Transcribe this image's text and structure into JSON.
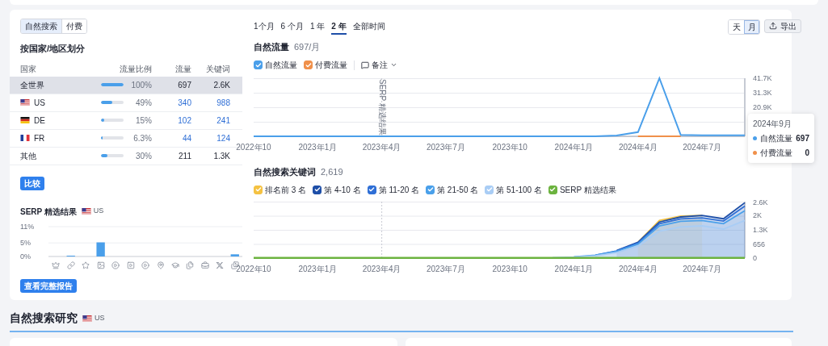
{
  "left": {
    "search_type_tabs": [
      {
        "label": "自然搜索",
        "selected": true
      },
      {
        "label": "付费",
        "selected": false
      }
    ],
    "country_title": "按国家/地区划分",
    "columns": [
      "国家",
      "流量比例",
      "流量",
      "关键词"
    ],
    "rows": [
      {
        "name": "全世界",
        "level": 1,
        "share": "100%",
        "traffic": "697",
        "keywords": "2.6K",
        "link": false,
        "selected": true
      },
      {
        "name": "US",
        "kind": "us",
        "level": 0.49,
        "share": "49%",
        "traffic": "340",
        "keywords": "988",
        "link": true,
        "selected": false
      },
      {
        "name": "DE",
        "kind": "de",
        "level": 0.15,
        "share": "15%",
        "traffic": "102",
        "keywords": "241",
        "link": true,
        "selected": false
      },
      {
        "name": "FR",
        "kind": "fr",
        "level": 0.063,
        "share": "6.3%",
        "traffic": "44",
        "keywords": "124",
        "link": true,
        "selected": false
      },
      {
        "name": "其他",
        "level": 0.3,
        "share": "30%",
        "traffic": "211",
        "keywords": "1.3K",
        "link": false,
        "selected": false
      }
    ],
    "compare_button": "比较",
    "serp": {
      "title": "SERP 精选结果",
      "country": {
        "code": "US",
        "kind": "us"
      },
      "chart_data": {
        "type": "bar",
        "values": [
          0,
          0.3,
          0,
          5.2,
          0,
          0,
          0,
          0,
          0,
          0,
          0,
          0,
          0.8
        ],
        "ylim": [
          0,
          11
        ],
        "yticks": [
          {
            "value": 0,
            "label": "0%"
          },
          {
            "value": 5,
            "label": "5%"
          },
          {
            "value": 11,
            "label": "11%"
          }
        ]
      }
    },
    "report_button": "查看完整报告"
  },
  "right": {
    "periods": [
      {
        "label": "1个月",
        "selected": false
      },
      {
        "label": "6 个月",
        "selected": false
      },
      {
        "label": "1 年",
        "selected": false
      },
      {
        "label": "2 年",
        "selected": true
      },
      {
        "label": "全部时间",
        "selected": false
      }
    ],
    "granularity": [
      {
        "label": "天",
        "selected": false
      },
      {
        "label": "月",
        "selected": true
      }
    ],
    "export_button": "导出",
    "traffic": {
      "title": "自然流量",
      "value": "697/月",
      "legend": [
        {
          "checked": true
        },
        {
          "checked": true
        }
      ],
      "notes_button": "备注",
      "chart_data": {
        "type": "line",
        "categories": [
          "2022年10",
          null,
          null,
          "2023年1月",
          null,
          null,
          "2023年4月",
          null,
          null,
          "2023年7月",
          null,
          null,
          "2023年10",
          null,
          null,
          "2024年1月",
          null,
          null,
          "2024年4月",
          null,
          null,
          "2024年7月",
          null,
          null
        ],
        "ylim": [
          0,
          41700
        ],
        "grid": true,
        "yticks": [
          {
            "value": 20900,
            "label": "20.9K"
          },
          {
            "value": 31300,
            "label": "31.3K"
          },
          {
            "value": 41700,
            "label": "41.7K"
          }
        ],
        "series": [
          {
            "name": "自然流量",
            "color": "#4a9fea",
            "values": [
              0,
              0,
              0,
              0,
              0,
              0,
              0,
              0,
              0,
              0,
              0,
              0,
              0,
              0,
              0,
              0,
              0,
              500,
              3000,
              41700,
              1000,
              700,
              700,
              700
            ]
          },
          {
            "name": "付费流量",
            "color": "#f0904a",
            "values": [
              null,
              null,
              null,
              null,
              null,
              null,
              null,
              null,
              null,
              null,
              null,
              null,
              null,
              null,
              null,
              null,
              null,
              null,
              0,
              0,
              0,
              null,
              null,
              null
            ]
          }
        ],
        "annotations": [
          {
            "x": "2023年4月",
            "text": "SERP 精选结果"
          }
        ]
      },
      "tooltip": {
        "title": "2024年9月",
        "rows": [
          {
            "label": "自然流量",
            "value": "697",
            "color": "#4a9fea"
          },
          {
            "label": "付费流量",
            "value": "0",
            "color": "#f0904a"
          }
        ]
      }
    },
    "keywords": {
      "title": "自然搜索关键词",
      "value": "2,619",
      "legend": [
        {
          "checked": true
        },
        {
          "checked": true
        },
        {
          "checked": true
        },
        {
          "checked": true
        },
        {
          "checked": true
        },
        {
          "checked": true
        }
      ],
      "chart_data": {
        "type": "area",
        "categories": [
          "2022年10",
          null,
          null,
          "2023年1月",
          null,
          null,
          "2023年4月",
          null,
          null,
          "2023年7月",
          null,
          null,
          "2023年10",
          null,
          null,
          "2024年1月",
          null,
          null,
          "2024年4月",
          null,
          null,
          "2024年7月",
          null,
          null
        ],
        "ylim": [
          0,
          2624
        ],
        "yticks": [
          {
            "value": 0,
            "label": "0"
          },
          {
            "value": 656,
            "label": "656"
          },
          {
            "value": 1300,
            "label": "1.3K"
          },
          {
            "value": 2000,
            "label": "2K"
          },
          {
            "value": 2600,
            "label": "2.6K"
          }
        ],
        "grid": true,
        "series": [
          {
            "name": "排名前 3 名",
            "color": "#f5c242",
            "values": [
              null,
              null,
              null,
              null,
              null,
              null,
              null,
              null,
              null,
              null,
              null,
              null,
              null,
              null,
              null,
              null,
              null,
              null,
              740,
              1750,
              1950,
              1980,
              null,
              null
            ]
          },
          {
            "name": "第 4-10 名",
            "color": "#1e4fa8",
            "values": [
              null,
              null,
              null,
              null,
              null,
              null,
              null,
              null,
              null,
              null,
              null,
              null,
              null,
              null,
              null,
              null,
              null,
              350,
              740,
              1680,
              1910,
              1980,
              1830,
              2570
            ]
          },
          {
            "name": "第 11-20 名",
            "color": "#2f6fd6",
            "values": [
              null,
              null,
              null,
              null,
              null,
              null,
              null,
              null,
              null,
              null,
              null,
              null,
              null,
              null,
              null,
              null,
              140,
              330,
              700,
              1600,
              1820,
              1870,
              1720,
              2420
            ]
          },
          {
            "name": "第 21-50 名",
            "color": "#4aa0ea",
            "values": [
              null,
              null,
              null,
              null,
              null,
              null,
              null,
              null,
              null,
              null,
              null,
              null,
              null,
              null,
              null,
              60,
              130,
              310,
              650,
              1500,
              1710,
              1750,
              1600,
              2200
            ]
          },
          {
            "name": "第 51-100 名",
            "color": "#a9cdf5",
            "values": [
              null,
              null,
              null,
              null,
              null,
              null,
              null,
              null,
              null,
              null,
              null,
              null,
              null,
              null,
              20,
              50,
              110,
              260,
              550,
              1250,
              1450,
              1500,
              1350,
              1750
            ]
          },
          {
            "name": "SERP 精选结果",
            "color": "#6cb33f",
            "values": [
              0,
              0,
              0,
              0,
              0,
              0,
              0,
              0,
              0,
              0,
              0,
              0,
              0,
              0,
              0,
              0,
              0,
              0,
              0,
              0,
              0,
              0,
              0,
              0
            ]
          }
        ],
        "annotations": [
          {
            "x": "2023年4月"
          }
        ]
      }
    }
  },
  "research": {
    "title": "自然搜索研究",
    "country": {
      "code": "US",
      "kind": "us"
    }
  }
}
